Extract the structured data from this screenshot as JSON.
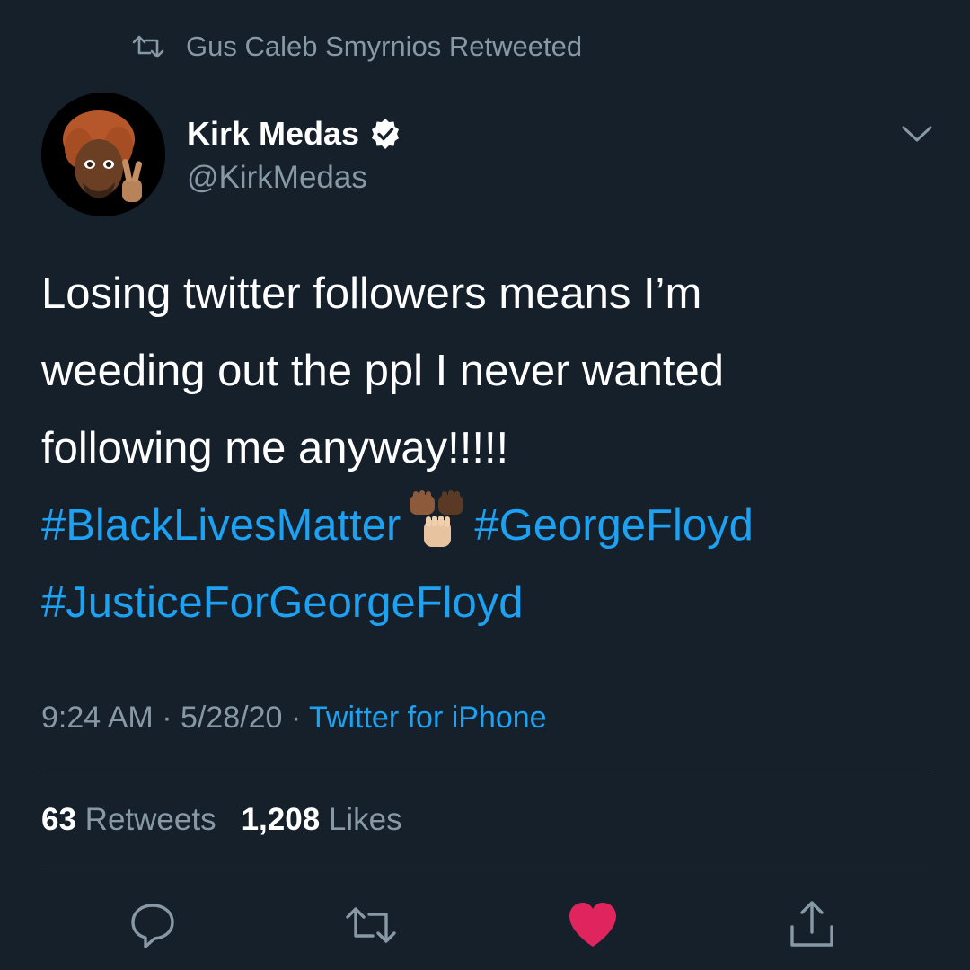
{
  "retweet_header": {
    "icon": "retweet-icon",
    "text": "Gus Caleb Smyrnios Retweeted"
  },
  "author": {
    "name": "Kirk Medas",
    "handle": "@KirkMedas",
    "verified": true,
    "avatar": "memoji-peace-sign-avatar"
  },
  "tweet": {
    "line1": "Losing twitter followers means I’m",
    "line2": "weeding out the ppl I never wanted",
    "line3": "following me anyway!!!!!",
    "hashtag1": "#BlackLivesMatter",
    "emoji": "raised-fists-emoji",
    "hashtag2": "#GeorgeFloyd",
    "hashtag3": "#JusticeForGeorgeFloyd"
  },
  "meta": {
    "time": "9:24 AM",
    "sep1": " · ",
    "date": "5/28/20",
    "sep2": " · ",
    "source": "Twitter for iPhone"
  },
  "stats": {
    "retweets_count": "63",
    "retweets_label": "Retweets",
    "likes_count": "1,208",
    "likes_label": "Likes"
  },
  "actions": {
    "reply": "reply-icon",
    "retweet": "retweet-icon",
    "like": "heart-icon",
    "share": "share-icon"
  },
  "colors": {
    "background": "#15202b",
    "text": "#ffffff",
    "secondary": "#8899a6",
    "link": "#1da1f2",
    "like": "#e0245e",
    "divider": "#38444d"
  }
}
